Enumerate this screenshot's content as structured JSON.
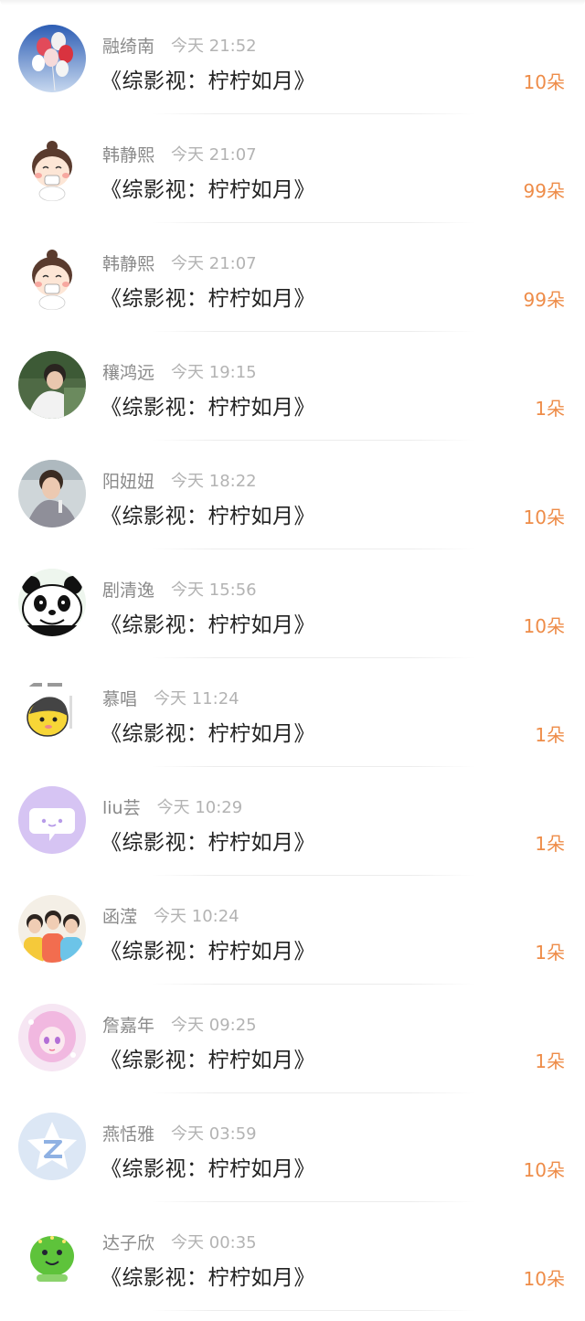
{
  "records": [
    {
      "name": "融绮南",
      "time": "今天 21:52",
      "title": "《综影视：柠柠如月》",
      "amount": "10朵",
      "avatar": "balloons-avatar"
    },
    {
      "name": "韩静熙",
      "time": "今天 21:07",
      "title": "《综影视：柠柠如月》",
      "amount": "99朵",
      "avatar": "cartoon-girl-avatar"
    },
    {
      "name": "韩静熙",
      "time": "今天 21:07",
      "title": "《综影视：柠柠如月》",
      "amount": "99朵",
      "avatar": "cartoon-girl-avatar"
    },
    {
      "name": "穰鸿远",
      "time": "今天 19:15",
      "title": "《综影视：柠柠如月》",
      "amount": "1朵",
      "avatar": "photo-avatar"
    },
    {
      "name": "阳妞妞",
      "time": "今天 18:22",
      "title": "《综影视：柠柠如月》",
      "amount": "10朵",
      "avatar": "photo-avatar"
    },
    {
      "name": "剧清逸",
      "time": "今天 15:56",
      "title": "《综影视：柠柠如月》",
      "amount": "10朵",
      "avatar": "panda-avatar"
    },
    {
      "name": "慕唱",
      "time": "今天 11:24",
      "title": "《综影视：柠柠如月》",
      "amount": "1朵",
      "avatar": "yellow-cartoon-avatar"
    },
    {
      "name": "liu芸",
      "time": "今天 10:29",
      "title": "《综影视：柠柠如月》",
      "amount": "1朵",
      "avatar": "purple-chat-avatar"
    },
    {
      "name": "函滢",
      "time": "今天 10:24",
      "title": "《综影视：柠柠如月》",
      "amount": "1朵",
      "avatar": "group-photo-avatar"
    },
    {
      "name": "詹嘉年",
      "time": "今天 09:25",
      "title": "《综影视：柠柠如月》",
      "amount": "1朵",
      "avatar": "anime-pink-avatar"
    },
    {
      "name": "燕恬雅",
      "time": "今天 03:59",
      "title": "《综影视：柠柠如月》",
      "amount": "10朵",
      "avatar": "default-qzone-avatar"
    },
    {
      "name": "达子欣",
      "time": "今天 00:35",
      "title": "《综影视：柠柠如月》",
      "amount": "10朵",
      "avatar": "green-cartoon-avatar"
    }
  ],
  "colors": {
    "accent": "#ee8c48",
    "name": "#8a8a8a",
    "time": "#b3b3b3",
    "title": "#222222"
  }
}
